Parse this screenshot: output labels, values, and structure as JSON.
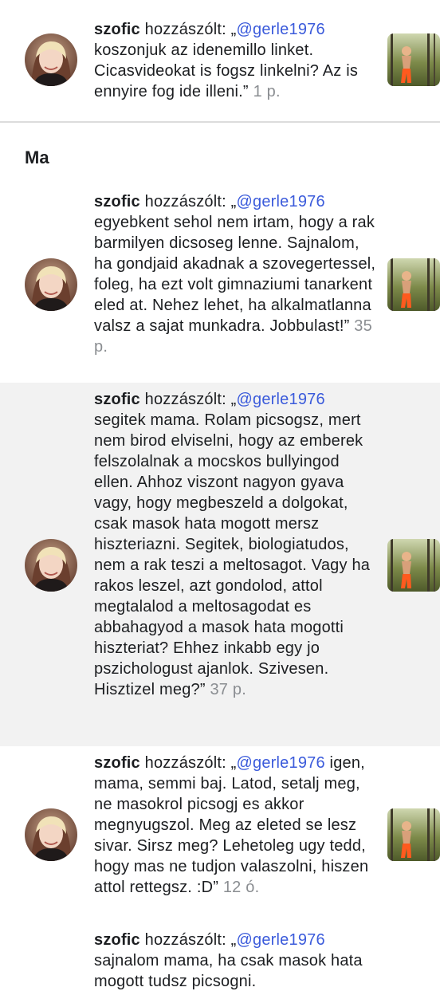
{
  "section": {
    "title": "Ma"
  },
  "notifications": [
    {
      "user": "szofic",
      "verb": " hozzászólt: „",
      "mention": "@gerle1976",
      "body": " koszonjuk az idenemillo linket. Cicasvideokat is fogsz linkelni? Az is ennyire fog ide illeni.”",
      "time": "1 p."
    },
    {
      "user": "szofic",
      "verb": " hozzászólt: „",
      "mention": "@gerle1976",
      "body": " egyebkent sehol nem irtam, hogy a rak barmilyen dicsoseg lenne. Sajnalom, ha gondjaid akadnak a szovegertessel, foleg, ha ezt volt gimnaziumi tanarkent eled at. Nehez lehet, ha alkalmatlanna valsz a sajat munkadra. Jobbulast!”",
      "time": "35 p."
    },
    {
      "user": "szofic",
      "verb": " hozzászólt: „",
      "mention": "@gerle1976",
      "body": " segitek mama. Rolam picsogsz, mert nem birod elviselni, hogy az emberek felszolalnak a mocskos bullyingod ellen. Ahhoz viszont nagyon gyava vagy, hogy megbeszeld a dolgokat, csak masok hata mogott mersz hiszteriazni. Segitek, biologiatudos, nem a rak teszi a meltosagot. Vagy ha rakos leszel, azt gondolod, attol megtalalod a meltosagodat es abbahagyod a masok hata mogotti hiszteriat? Ehhez inkabb egy jo pszichologust ajanlok. Szivesen. Hisztizel meg?”",
      "time": "37 p."
    },
    {
      "user": "szofic",
      "verb": " hozzászólt: „",
      "mention": "@gerle1976",
      "body": " igen, mama, semmi baj. Latod, setalj meg, ne masokrol picsogj es akkor megnyugszol. Meg az eleted se lesz sivar. Sirsz meg? Lehetoleg ugy tedd, hogy mas ne tudjon valaszolni, hiszen attol rettegsz. :D”",
      "time": "12 ó."
    },
    {
      "user": "szofic",
      "verb": " hozzászólt: „",
      "mention": "@gerle1976",
      "body": " sajnalom mama, ha csak masok hata mogott tudsz picsogni.",
      "time": ""
    }
  ]
}
